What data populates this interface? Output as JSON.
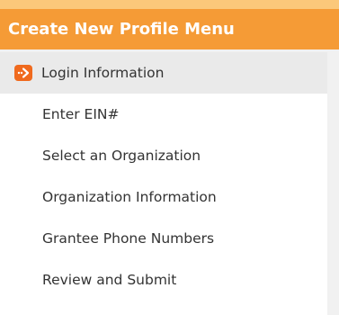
{
  "menu": {
    "title": "Create New Profile Menu",
    "items": [
      {
        "label": "Login Information",
        "active": true
      },
      {
        "label": "Enter EIN#",
        "active": false
      },
      {
        "label": "Select an Organization",
        "active": false
      },
      {
        "label": "Organization Information",
        "active": false
      },
      {
        "label": "Grantee Phone Numbers",
        "active": false
      },
      {
        "label": "Review and Submit",
        "active": false
      }
    ]
  },
  "colors": {
    "header_bg": "#f59b36",
    "top_strip": "#fbc87a",
    "active_bg": "#eaeaea",
    "icon_bg": "#f06a1e"
  },
  "icons": {
    "active_item": "arrow-right-icon"
  }
}
